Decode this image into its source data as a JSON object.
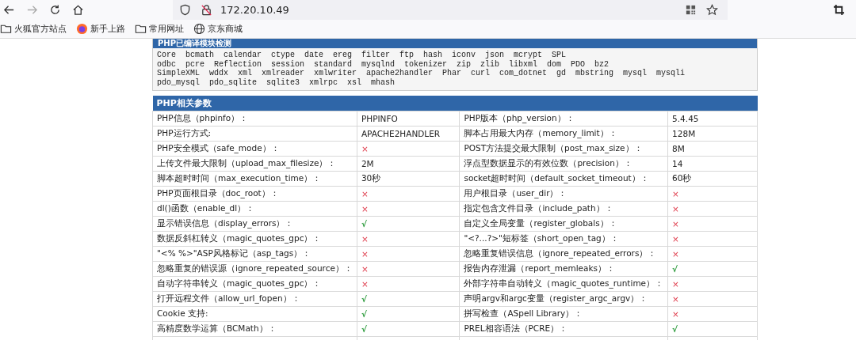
{
  "browser": {
    "url": "172.20.10.49",
    "bookmarks": [
      {
        "kind": "folder",
        "label": "火狐官方站点"
      },
      {
        "kind": "logo",
        "label": "新手上路"
      },
      {
        "kind": "folder",
        "label": "常用网址"
      },
      {
        "kind": "globe",
        "label": "京东商城"
      }
    ]
  },
  "modules": {
    "title": "PHP已编译模块检测",
    "lines": [
      "Core  bcmath  calendar  ctype  date  ereg  filter  ftp  hash  iconv  json  mcrypt  SPL",
      "odbc  pcre  Reflection  session  standard  mysqlnd  tokenizer  zip  zlib  libxml  dom  PDO  bz2",
      "SimpleXML  wddx  xml  xmlreader  xmlwriter  apache2handler  Phar  curl  com_dotnet  gd  mbstring  mysql  mysqli",
      "pdo_mysql  pdo_sqlite  sqlite3  xmlrpc  xsl  mhash"
    ]
  },
  "params": {
    "title": "PHP相关参数",
    "rows": [
      [
        {
          "label": "PHP信息（phpinfo）：",
          "value": "PHPINFO",
          "kind": "text"
        },
        {
          "label": "PHP版本（php_version）：",
          "value": "5.4.45",
          "kind": "text"
        }
      ],
      [
        {
          "label": "PHP运行方式:",
          "value": "APACHE2HANDLER",
          "kind": "text"
        },
        {
          "label": "脚本占用最大内存（memory_limit）：",
          "value": "128M",
          "kind": "text"
        }
      ],
      [
        {
          "label": "PHP安全模式（safe_mode）：",
          "value": "×",
          "kind": "no"
        },
        {
          "label": "POST方法提交最大限制（post_max_size）：",
          "value": "8M",
          "kind": "text"
        }
      ],
      [
        {
          "label": "上传文件最大限制（upload_max_filesize）：",
          "value": "2M",
          "kind": "text"
        },
        {
          "label": "浮点型数据显示的有效位数（precision）：",
          "value": "14",
          "kind": "text"
        }
      ],
      [
        {
          "label": "脚本超时时间（max_execution_time）：",
          "value": "30秒",
          "kind": "text"
        },
        {
          "label": "socket超时时间（default_socket_timeout）：",
          "value": "60秒",
          "kind": "text"
        }
      ],
      [
        {
          "label": "PHP页面根目录（doc_root）：",
          "value": "×",
          "kind": "no"
        },
        {
          "label": "用户根目录（user_dir）：",
          "value": "×",
          "kind": "no"
        }
      ],
      [
        {
          "label": "dl()函数（enable_dl）：",
          "value": "×",
          "kind": "no"
        },
        {
          "label": "指定包含文件目录（include_path）：",
          "value": "×",
          "kind": "no"
        }
      ],
      [
        {
          "label": "显示错误信息（display_errors）：",
          "value": "√",
          "kind": "yes"
        },
        {
          "label": "自定义全局变量（register_globals）：",
          "value": "×",
          "kind": "no"
        }
      ],
      [
        {
          "label": "数据反斜杠转义（magic_quotes_gpc）：",
          "value": "×",
          "kind": "no"
        },
        {
          "label": "\"<?...?>\"短标签（short_open_tag）：",
          "value": "×",
          "kind": "no"
        }
      ],
      [
        {
          "label": "\"<% %>\"ASP风格标记（asp_tags）：",
          "value": "×",
          "kind": "no"
        },
        {
          "label": "忽略重复错误信息（ignore_repeated_errors）：",
          "value": "×",
          "kind": "no"
        }
      ],
      [
        {
          "label": "忽略重复的错误源（ignore_repeated_source）：",
          "value": "×",
          "kind": "no"
        },
        {
          "label": "报告内存泄漏（report_memleaks）：",
          "value": "√",
          "kind": "yes"
        }
      ],
      [
        {
          "label": "自动字符串转义（magic_quotes_gpc）：",
          "value": "×",
          "kind": "no"
        },
        {
          "label": "外部字符串自动转义（magic_quotes_runtime）：",
          "value": "×",
          "kind": "no"
        }
      ],
      [
        {
          "label": "打开远程文件（allow_url_fopen）：",
          "value": "√",
          "kind": "yes"
        },
        {
          "label": "声明argv和argc变量（register_argc_argv）：",
          "value": "×",
          "kind": "no"
        }
      ],
      [
        {
          "label": "Cookie 支持:",
          "value": "√",
          "kind": "yes"
        },
        {
          "label": "拼写检查（ASpell Library）：",
          "value": "×",
          "kind": "no"
        }
      ],
      [
        {
          "label": "高精度数学运算（BCMath）：",
          "value": "√",
          "kind": "yes"
        },
        {
          "label": "PREL相容语法（PCRE）：",
          "value": "√",
          "kind": "yes"
        }
      ]
    ]
  }
}
